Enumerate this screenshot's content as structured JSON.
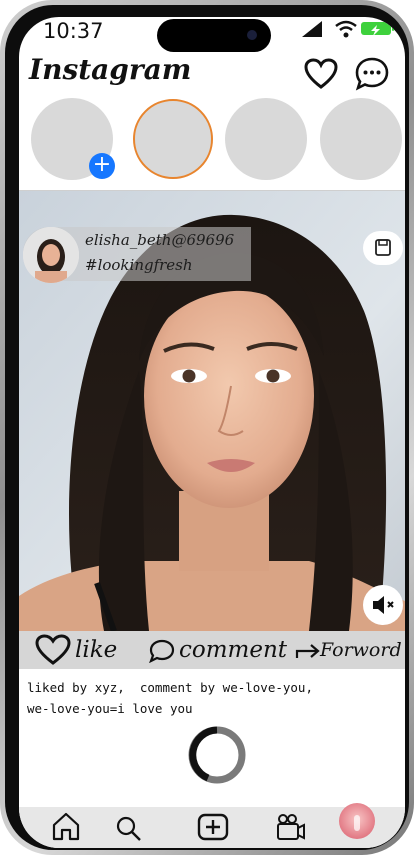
{
  "status_bar": {
    "time": "10:37"
  },
  "header": {
    "logo": "Instagram"
  },
  "stories": {
    "count": 4,
    "active_index": 1
  },
  "post": {
    "username": "elisha_beth@69696",
    "hashtag": "#lookingfresh"
  },
  "actions": {
    "like_label": "like",
    "comment_label": "comment",
    "forward_label": "Forword"
  },
  "caption": {
    "line1": "liked by xyz,  comment by we-love-you,",
    "line2": "we-love-you=i love you"
  },
  "colors": {
    "active_story_ring": "#e8852e",
    "add_story_button": "#1677ff",
    "battery": "#3ed13c"
  },
  "icons": [
    "signal-icon",
    "wifi-icon",
    "battery-icon",
    "heart-icon",
    "messenger-icon",
    "plus-icon",
    "save-icon",
    "mute-icon",
    "heart-outline-icon",
    "comment-icon",
    "forward-arrow-icon",
    "home-icon",
    "search-icon",
    "add-post-icon",
    "reels-icon",
    "profile-avatar"
  ]
}
